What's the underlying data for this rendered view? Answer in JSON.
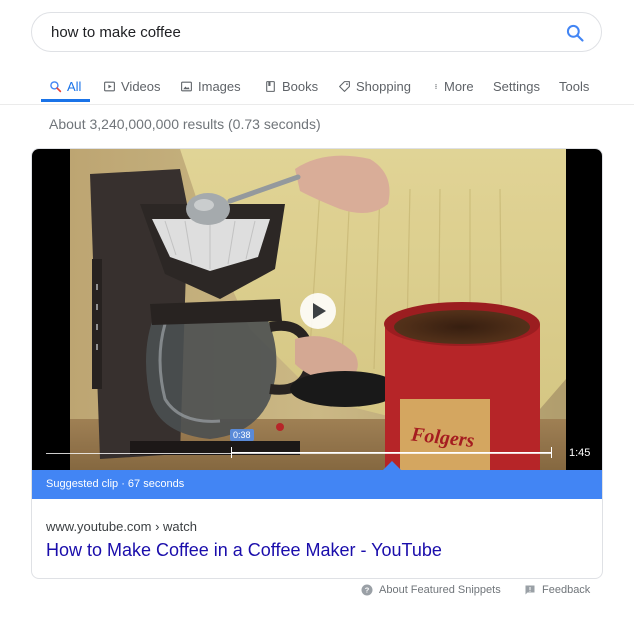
{
  "search": {
    "query": "how to make coffee"
  },
  "tabs": [
    {
      "label": "All",
      "icon": "search-icon",
      "active": true
    },
    {
      "label": "Videos",
      "icon": "video-icon"
    },
    {
      "label": "Images",
      "icon": "image-icon"
    },
    {
      "label": "Books",
      "icon": "book-icon"
    },
    {
      "label": "Shopping",
      "icon": "tag-icon"
    },
    {
      "label": "More",
      "icon": "more-vert-icon"
    },
    {
      "label": "Settings"
    },
    {
      "label": "Tools"
    }
  ],
  "result_stats": "About 3,240,000,000 results (0.73 seconds)",
  "featured_snippet": {
    "video": {
      "clip_start": "0:38",
      "duration": "1:45",
      "clip_label": "Suggested clip · 67 seconds",
      "play_icon": "play-icon"
    },
    "source": "www.youtube.com › watch",
    "title": "How to Make Coffee in a Coffee Maker - YouTube"
  },
  "footer": {
    "about": "About Featured Snippets",
    "feedback": "Feedback"
  },
  "colors": {
    "accent": "#1a73e8",
    "link": "#1a0dab",
    "clip_bar": "#4285f4",
    "muted": "#70757a"
  }
}
